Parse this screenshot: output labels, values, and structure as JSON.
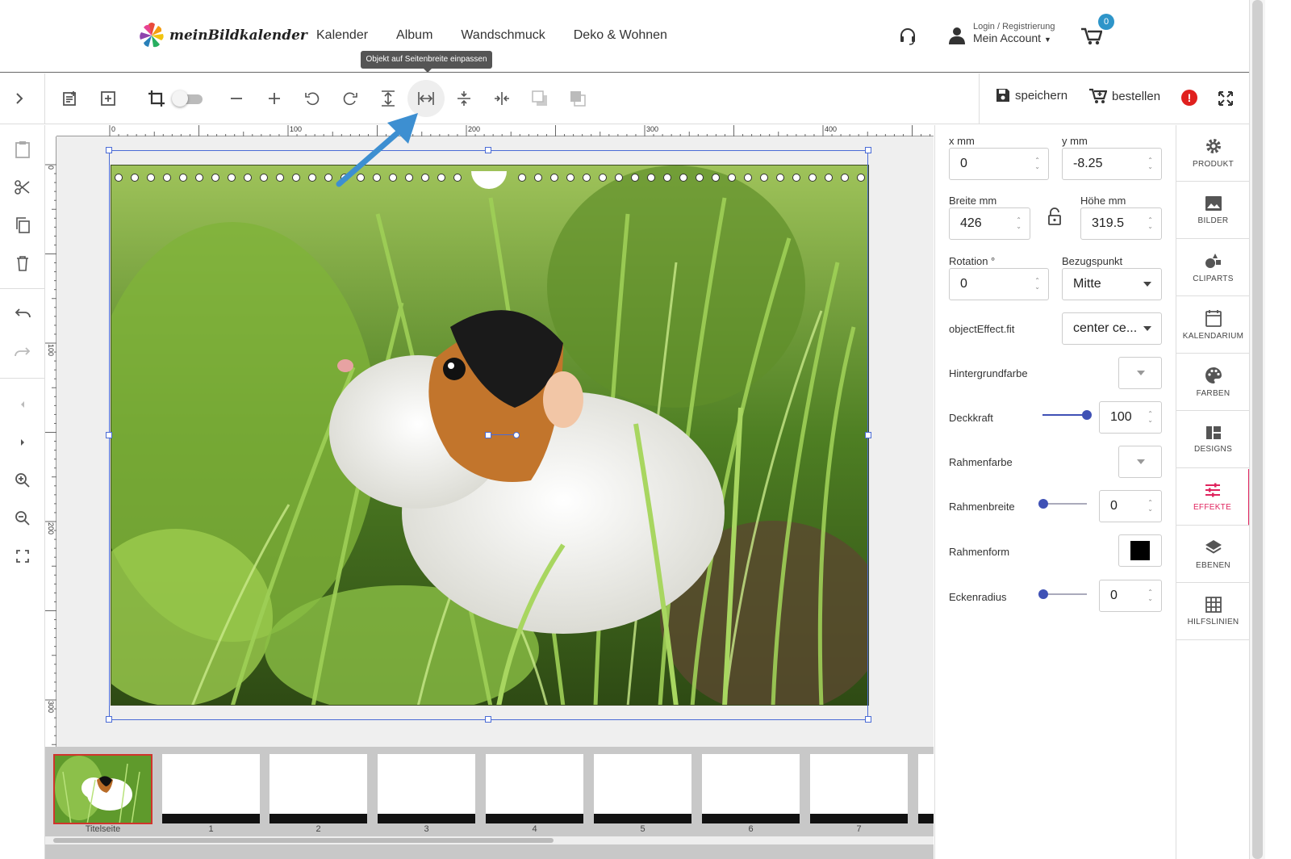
{
  "header": {
    "logo_text": "meinBildkalender",
    "nav": [
      "Kalender",
      "Album",
      "Wandschmuck",
      "Deko & Wohnen"
    ],
    "login_label": "Login / Registrierung",
    "account_label": "Mein Account",
    "cart_count": "0"
  },
  "tooltip": "Objekt auf Seitenbreite einpassen",
  "toolbar": {
    "save_label": "speichern",
    "order_label": "bestellen"
  },
  "ruler": {
    "top_ticks": [
      "0",
      "100",
      "200",
      "300",
      "400"
    ],
    "left_ticks": [
      "0",
      "100",
      "200",
      "300"
    ]
  },
  "properties": {
    "x_label": "x mm",
    "x_value": "0",
    "y_label": "y mm",
    "y_value": "-8.25",
    "width_label": "Breite mm",
    "width_value": "426",
    "height_label": "Höhe mm",
    "height_value": "319.5",
    "rotation_label": "Rotation °",
    "rotation_value": "0",
    "anchor_label": "Bezugspunkt",
    "anchor_value": "Mitte",
    "fit_label": "objectEffect.fit",
    "fit_value": "center ce...",
    "bg_color_label": "Hintergrundfarbe",
    "opacity_label": "Deckkraft",
    "opacity_value": "100",
    "frame_color_label": "Rahmenfarbe",
    "frame_width_label": "Rahmenbreite",
    "frame_width_value": "0",
    "frame_shape_label": "Rahmenform",
    "corner_radius_label": "Eckenradius",
    "corner_radius_value": "0"
  },
  "tabs": [
    "PRODUKT",
    "BILDER",
    "CLIPARTS",
    "KALENDARIUM",
    "FARBEN",
    "DESIGNS",
    "EFFEKTE",
    "EBENEN",
    "HILFSLINIEN"
  ],
  "thumbnails": [
    "Titelseite",
    "1",
    "2",
    "3",
    "4",
    "5",
    "6",
    "7"
  ],
  "colors": {
    "accent": "#3f51b5",
    "active_tab": "#e0245e",
    "badge": "#2e95c9"
  }
}
